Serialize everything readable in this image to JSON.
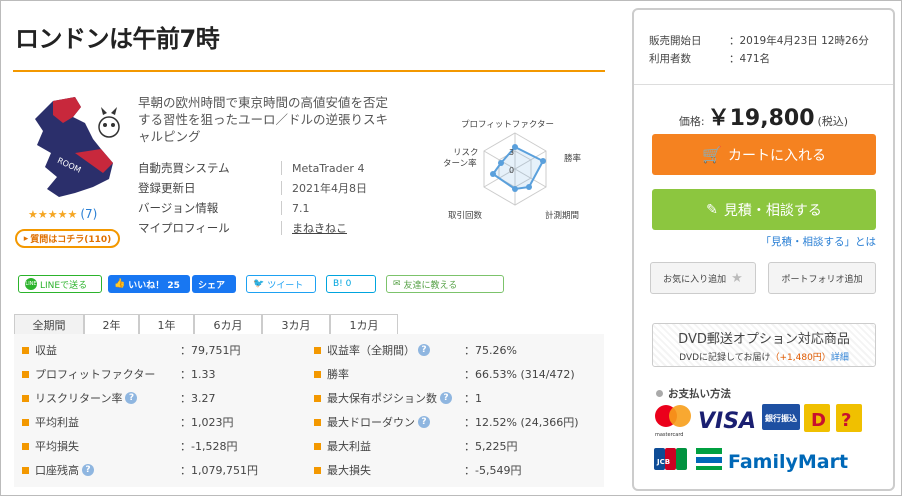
{
  "title": "ロンドンは午前7時",
  "rating": {
    "stars": "★★★★★",
    "count": "(7)"
  },
  "qa_button": "質問はコチラ(110)",
  "description": "早朝の欧州時間で東京時間の高値安値を否定する習性を狙ったユーロ／ドルの逆張りスキャルピング",
  "info": [
    {
      "label": "自動売買システム",
      "value": "MetaTrader 4"
    },
    {
      "label": "登録更新日",
      "value": "2021年4月8日"
    },
    {
      "label": "バージョン情報",
      "value": "7.1"
    },
    {
      "label": "マイプロフィール",
      "value": "まねきねこ"
    }
  ],
  "radar": {
    "labels": [
      "プロフィットファクター",
      "勝率",
      "計測期間",
      "取引回数",
      "リスク",
      "ターン率"
    ],
    "ticks": [
      "3",
      "0"
    ]
  },
  "social": {
    "line": "LINEで送る",
    "like": "いいね！ 25",
    "share": "シェア",
    "tweet": "ツイート",
    "hatena": "B! 0",
    "mail": "友達に教える"
  },
  "tabs": [
    "全期間",
    "2年",
    "1年",
    "6カ月",
    "3カ月",
    "1カ月"
  ],
  "stats_left": [
    {
      "label": "収益",
      "value": "：79,751円",
      "help": false
    },
    {
      "label": "プロフィットファクター",
      "value": "：1.33",
      "help": false
    },
    {
      "label": "リスクリターン率",
      "value": "：3.27",
      "help": true
    },
    {
      "label": "平均利益",
      "value": "：1,023円",
      "help": false
    },
    {
      "label": "平均損失",
      "value": "：-1,528円",
      "help": false
    },
    {
      "label": "口座残高",
      "value": "：1,079,751円",
      "help": true
    }
  ],
  "stats_right": [
    {
      "label": "収益率（全期間）",
      "value": "：75.26%",
      "help": true
    },
    {
      "label": "勝率",
      "value": "：66.53% (314/472)",
      "help": false
    },
    {
      "label": "最大保有ポジション数",
      "value": "：1",
      "help": true
    },
    {
      "label": "最大ドローダウン",
      "value": "：12.52% (24,366円)",
      "help": true
    },
    {
      "label": "最大利益",
      "value": "：5,225円",
      "help": false
    },
    {
      "label": "最大損失",
      "value": "：-5,549円",
      "help": false
    }
  ],
  "sidebar": {
    "release_label": "販売開始日",
    "release_value": "：2019年4月23日 12時26分",
    "users_label": "利用者数",
    "users_value": "：471名",
    "price_label": "価格:",
    "price": "￥19,800",
    "tax": "(税込)",
    "cart": "カートに入れる",
    "estimate": "見積・相談する",
    "estimate_link": "「見積・相談する」とは",
    "favorite": "お気に入り追加",
    "portfolio": "ポートフォリオ追加",
    "dvd_title": "DVD郵送オプション対応商品",
    "dvd_sub": "DVDに記録してお届け",
    "dvd_price": "（+1,480円）",
    "dvd_link": "詳細",
    "payment_title": "お支払い方法",
    "payment": {
      "visa": "VISA",
      "bank": "銀行振込",
      "famima": "FamilyMart",
      "jcb": "JCB",
      "master": "mastercard"
    }
  },
  "colors": {
    "accent": "#f39800",
    "cart": "#f58220",
    "estimate": "#8cc63f",
    "link": "#2a7fd4"
  }
}
